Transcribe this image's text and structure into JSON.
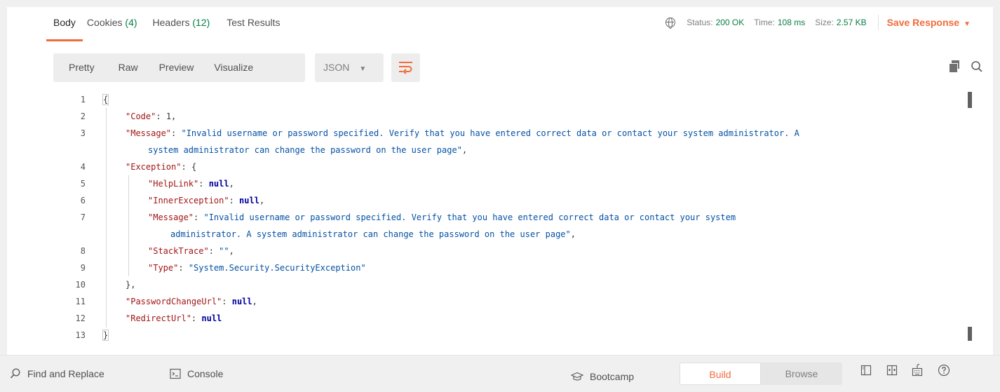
{
  "response_tabs": [
    {
      "label": "Body",
      "count": ""
    },
    {
      "label": "Cookies",
      "count": "(4)"
    },
    {
      "label": "Headers",
      "count": "(12)"
    },
    {
      "label": "Test Results",
      "count": ""
    }
  ],
  "status": {
    "status_label": "Status:",
    "status_value": "200 OK",
    "time_label": "Time:",
    "time_value": "108 ms",
    "size_label": "Size:",
    "size_value": "2.57 KB",
    "save_label": "Save Response"
  },
  "view_modes": [
    "Pretty",
    "Raw",
    "Preview",
    "Visualize"
  ],
  "format_select": "JSON",
  "code_lines": [
    {
      "n": "1",
      "html": "{"
    },
    {
      "n": "2",
      "key": "\"Code\"",
      "sep": ": ",
      "val": "1",
      "vtype": "num",
      "tail": ","
    },
    {
      "n": "3",
      "key": "\"Message\"",
      "sep": ": ",
      "val": "\"Invalid username or password specified. Verify that you have entered correct data or contact your system administrator. A",
      "val2": "system administrator can change the password on the user page\"",
      "vtype": "str",
      "tail": ","
    },
    {
      "n": "4",
      "key": "\"Exception\"",
      "sep": ": ",
      "val": "{",
      "vtype": "punc",
      "tail": ""
    },
    {
      "n": "5",
      "key": "\"HelpLink\"",
      "sep": ": ",
      "val": "null",
      "vtype": "kw",
      "tail": ","
    },
    {
      "n": "6",
      "key": "\"InnerException\"",
      "sep": ": ",
      "val": "null",
      "vtype": "kw",
      "tail": ","
    },
    {
      "n": "7",
      "key": "\"Message\"",
      "sep": ": ",
      "val": "\"Invalid username or password specified. Verify that you have entered correct data or contact your system",
      "val2": "administrator. A system administrator can change the password on the user page\"",
      "vtype": "str",
      "tail": ","
    },
    {
      "n": "8",
      "key": "\"StackTrace\"",
      "sep": ": ",
      "val": "\"\"",
      "vtype": "str",
      "tail": ","
    },
    {
      "n": "9",
      "key": "\"Type\"",
      "sep": ": ",
      "val": "\"System.Security.SecurityException\"",
      "vtype": "str",
      "tail": ""
    },
    {
      "n": "10",
      "html": "},"
    },
    {
      "n": "11",
      "key": "\"PasswordChangeUrl\"",
      "sep": ": ",
      "val": "null",
      "vtype": "kw",
      "tail": ","
    },
    {
      "n": "12",
      "key": "\"RedirectUrl\"",
      "sep": ": ",
      "val": "null",
      "vtype": "kw",
      "tail": ""
    },
    {
      "n": "13",
      "html": "}"
    }
  ],
  "bottom_bar": {
    "find_replace": "Find and Replace",
    "console": "Console",
    "bootcamp": "Bootcamp",
    "build": "Build",
    "browse": "Browse"
  },
  "colors": {
    "accent": "#f26b3a",
    "success": "#097e44"
  },
  "icons": [
    "globe-icon",
    "wrap-lines-icon",
    "copy-icon",
    "search-icon",
    "console-icon",
    "bootcamp-icon",
    "two-pane-icon",
    "three-pane-icon",
    "keyboard-icon",
    "help-icon"
  ]
}
